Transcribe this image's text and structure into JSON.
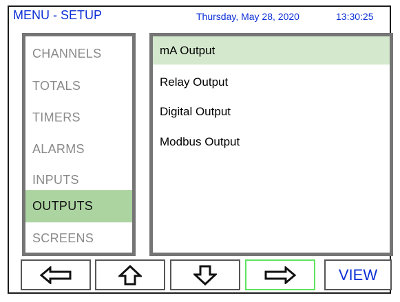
{
  "header": {
    "title": "MENU - SETUP",
    "date": "Thursday, May 28, 2020",
    "time": "13:30:25"
  },
  "categories": [
    {
      "label": "CHANNELS",
      "selected": false
    },
    {
      "label": "TOTALS",
      "selected": false
    },
    {
      "label": "TIMERS",
      "selected": false
    },
    {
      "label": "ALARMS",
      "selected": false
    },
    {
      "label": "INPUTS",
      "selected": false
    },
    {
      "label": "OUTPUTS",
      "selected": true
    },
    {
      "label": "SCREENS",
      "selected": false
    }
  ],
  "options": [
    {
      "label": "mA Output",
      "selected": true
    },
    {
      "label": "Relay Output",
      "selected": false
    },
    {
      "label": "Digital Output",
      "selected": false
    },
    {
      "label": "Modbus Output",
      "selected": false
    }
  ],
  "nav": {
    "buttons": [
      {
        "icon": "arrow-left-icon"
      },
      {
        "icon": "arrow-up-icon"
      },
      {
        "icon": "arrow-down-icon"
      },
      {
        "icon": "arrow-right-icon",
        "highlighted": true
      }
    ],
    "view_label": "VIEW"
  },
  "colors": {
    "accent_text": "#0b2fd6",
    "selected_category_bg": "#acd4a1",
    "selected_option_bg": "#d4e8cd",
    "active_button_border": "#5fe35f",
    "unselected_text": "#8a8a8a"
  }
}
